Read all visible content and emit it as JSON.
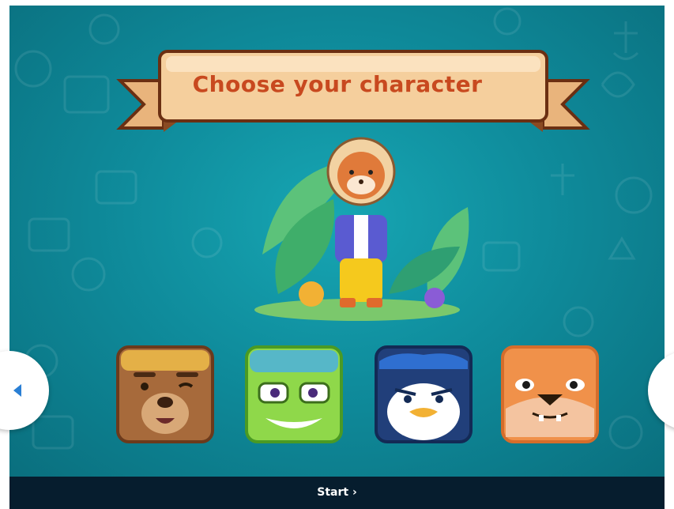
{
  "title": "Choose your character",
  "start_label": "Start ›",
  "characters": [
    "bear",
    "crocodile",
    "penguin",
    "dog"
  ],
  "selected_character": "fox astronaut",
  "colors": {
    "background": "#0f8c9c",
    "title_text": "#c8491f",
    "banner": "#f4c996",
    "footer": "#061d2e",
    "nav_arrow": "#2a7fd4"
  },
  "icons": {
    "prev": "chevron-left-icon",
    "next": "chevron-right-icon"
  }
}
